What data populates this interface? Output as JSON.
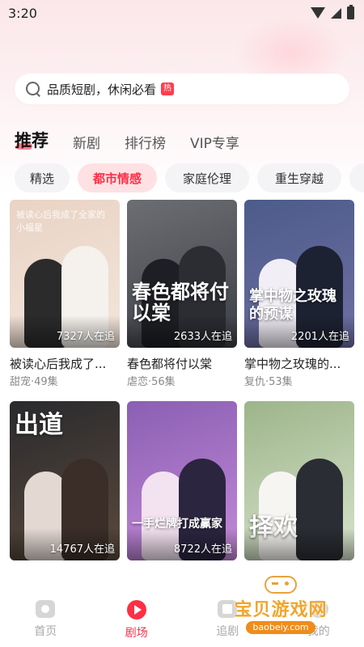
{
  "status_bar": {
    "time": "3:20"
  },
  "search": {
    "placeholder": "品质短剧，休闲必看",
    "badge": "热"
  },
  "main_tabs": [
    {
      "label": "推荐",
      "active": true
    },
    {
      "label": "新剧",
      "active": false
    },
    {
      "label": "排行榜",
      "active": false
    },
    {
      "label": "VIP专享",
      "active": false
    }
  ],
  "categories": [
    {
      "label": "精选",
      "active": false
    },
    {
      "label": "都市情感",
      "active": true
    },
    {
      "label": "家庭伦理",
      "active": false
    },
    {
      "label": "重生穿越",
      "active": false
    }
  ],
  "cards": [
    {
      "poster_text": "被读心后我成了全家的小福星",
      "watchers": "7327人在追",
      "title": "被读心后我成了...",
      "meta": "甜宠·49集",
      "colors": [
        "#e9d3c4",
        "#f3e6dc",
        "#2b2b2b",
        "#f5f1ec"
      ]
    },
    {
      "poster_text": "春色都将付以棠",
      "watchers": "2633人在追",
      "title": "春色都将付以棠",
      "meta": "虐恋·56集",
      "colors": [
        "#6c6e73",
        "#3c3f46",
        "#1e1f24",
        "#2c2d33"
      ]
    },
    {
      "poster_text": "掌中物之玫瑰的预谋",
      "watchers": "2201人在追",
      "title": "掌中物之玫瑰的...",
      "meta": "复仇·53集",
      "colors": [
        "#4c5c8a",
        "#6f6fa3",
        "#f2eef6",
        "#1d2233"
      ]
    },
    {
      "poster_text": "出道",
      "watchers": "14767人在追",
      "title": "",
      "meta": "",
      "colors": [
        "#2a2a2e",
        "#5a4a3c",
        "#e3d9d2",
        "#3b2e28"
      ]
    },
    {
      "poster_text": "一手烂牌打成赢家",
      "watchers": "8722人在追",
      "title": "",
      "meta": "",
      "colors": [
        "#8a5fb3",
        "#c48ad8",
        "#f3e2f0",
        "#2b2540"
      ]
    },
    {
      "poster_text": "择欢",
      "watchers": "",
      "title": "",
      "meta": "",
      "colors": [
        "#9db58a",
        "#d8e3cd",
        "#f7f5f1",
        "#2a2d33"
      ]
    }
  ],
  "bottom_nav": [
    {
      "label": "首页",
      "icon": "home-icon",
      "active": false
    },
    {
      "label": "剧场",
      "icon": "theater-icon",
      "active": true
    },
    {
      "label": "追剧",
      "icon": "follow-icon",
      "active": false
    },
    {
      "label": "我的",
      "icon": "mine-icon",
      "active": false
    }
  ],
  "watermark": {
    "text": "宝贝游戏网",
    "url": "baobeiy.com"
  },
  "theme": {
    "accent": "#ff2f45",
    "chip_active_bg": "#ffe1e4"
  }
}
